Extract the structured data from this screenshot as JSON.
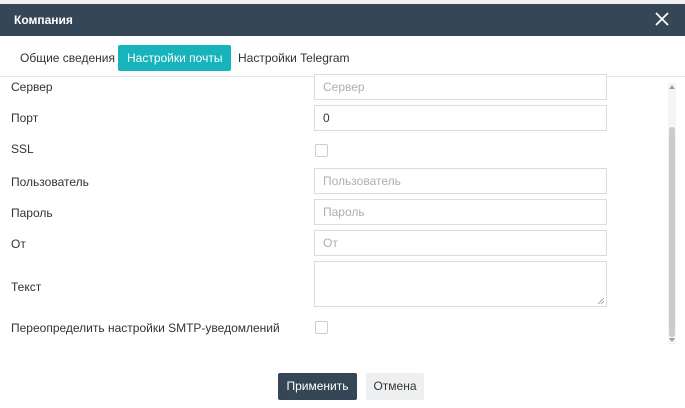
{
  "dialog": {
    "title": "Компания",
    "close_icon": "close-icon"
  },
  "tabs": [
    {
      "label": "Общие сведения",
      "active": false
    },
    {
      "label": "Настройки почты",
      "active": true
    },
    {
      "label": "Настройки Telegram",
      "active": false
    }
  ],
  "form": {
    "server": {
      "label": "Сервер",
      "placeholder": "Сервер",
      "value": ""
    },
    "port": {
      "label": "Порт",
      "value": "0"
    },
    "ssl": {
      "label": "SSL",
      "checked": false
    },
    "user": {
      "label": "Пользователь",
      "placeholder": "Пользователь",
      "value": ""
    },
    "password": {
      "label": "Пароль",
      "placeholder": "Пароль",
      "value": ""
    },
    "from": {
      "label": "От",
      "placeholder": "От",
      "value": ""
    },
    "text": {
      "label": "Текст",
      "value": ""
    },
    "override_smtp": {
      "label": "Переопределить настройки SMTP-уведомлений",
      "checked": false
    }
  },
  "buttons": {
    "apply": "Применить",
    "cancel": "Отмена"
  },
  "colors": {
    "titlebar": "#354657",
    "active_tab": "#17b4bc",
    "primary_button": "#354657"
  }
}
